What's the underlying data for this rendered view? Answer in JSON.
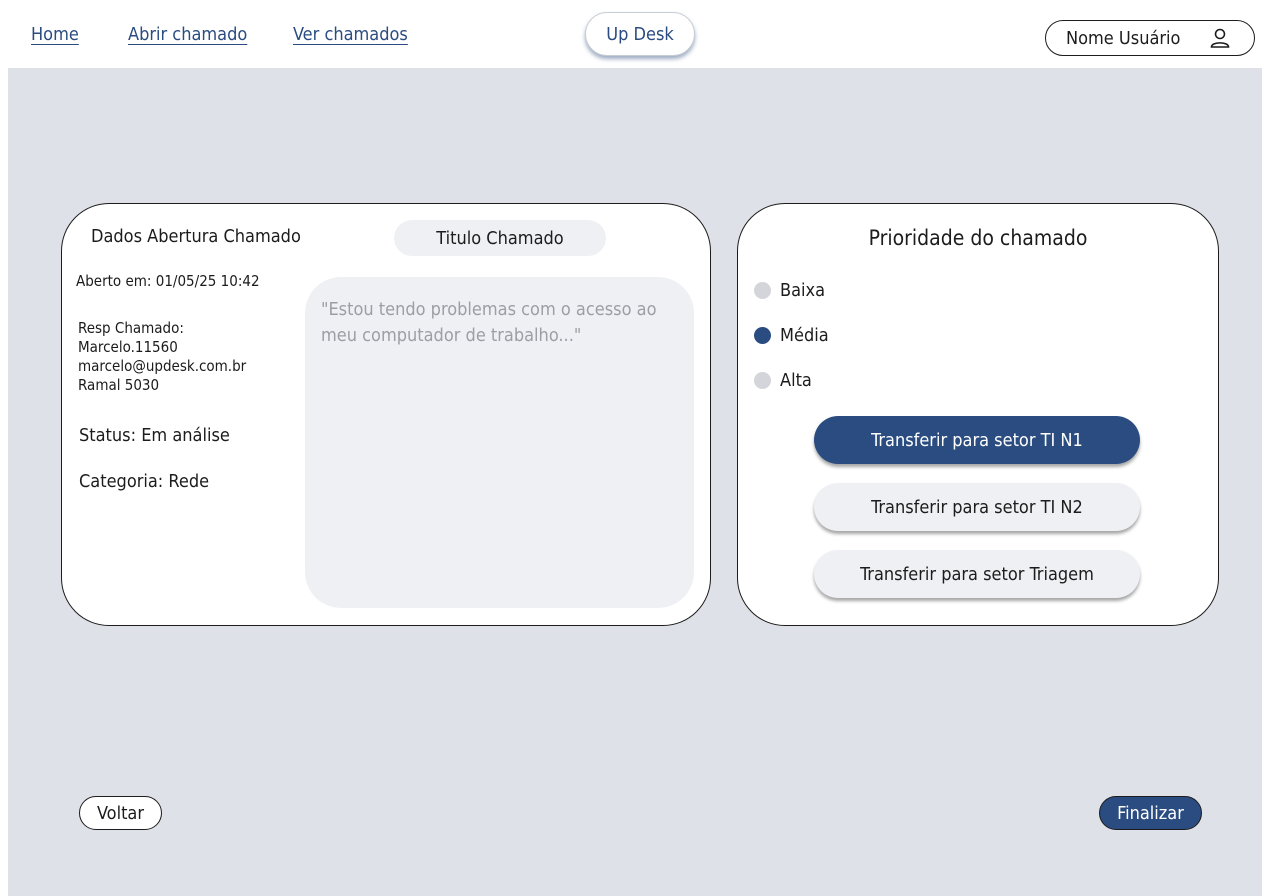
{
  "nav": {
    "links": [
      "Home",
      "Abrir chamado",
      "Ver chamados"
    ],
    "brand": "Up Desk",
    "user_name": "Nome Usuário",
    "user_icon": "user-icon"
  },
  "ticket": {
    "section_title": "Dados Abertura Chamado",
    "title": "Titulo Chamado",
    "opened_at": "Aberto em: 01/05/25 10:42",
    "responsible": {
      "label": "Resp Chamado:",
      "name": "Marcelo.11560",
      "email": "marcelo@updesk.com.br",
      "extension": "Ramal 5030"
    },
    "status": "Status: Em análise",
    "category": "Categoria: Rede",
    "description": "\"Estou tendo problemas com o acesso ao meu computador de trabalho...\""
  },
  "priority": {
    "title": "Prioridade do chamado",
    "options": [
      "Baixa",
      "Média",
      "Alta"
    ],
    "selected": "Média"
  },
  "transfer": {
    "buttons": [
      "Transferir para setor TI N1",
      "Transferir para setor TI N2",
      "Transferir para setor Triagem"
    ],
    "active": "Transferir para setor TI N1"
  },
  "actions": {
    "back": "Voltar",
    "finish": "Finalizar"
  },
  "colors": {
    "accent": "#2b4c80",
    "background": "#dfe1e8",
    "field": "#eff0f4",
    "radio_idle": "#d3d5da"
  }
}
